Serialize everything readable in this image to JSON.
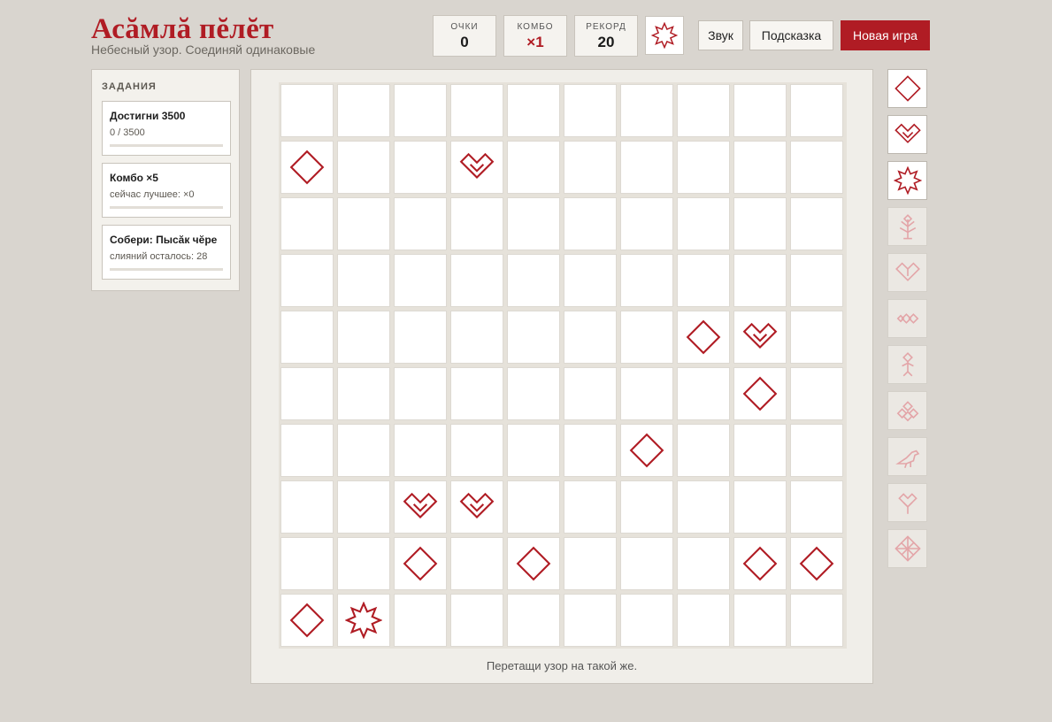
{
  "header": {
    "title": "Асăмлă пĕлĕт",
    "subtitle": "Небесный узор. Соединяй одинаковые"
  },
  "stats": {
    "score": {
      "label": "ОЧКИ",
      "value": "0"
    },
    "combo": {
      "label": "КОМБО",
      "value": "×1"
    },
    "record": {
      "label": "РЕКОРД",
      "value": "20"
    }
  },
  "toolbar": {
    "sound_label": "Звук",
    "hint_label": "Подсказка",
    "new_game_label": "Новая игра"
  },
  "tasks": {
    "heading": "ЗАДАНИЯ",
    "items": [
      {
        "title": "Достигни 3500",
        "subtitle": "0 / 3500",
        "progress": 0
      },
      {
        "title": "Комбо ×5",
        "subtitle": "сейчас лучшее: ×0",
        "progress": 0
      },
      {
        "title": "Собери: Пысăк чĕре",
        "subtitle": "слияний осталось: 28",
        "progress": 0
      }
    ]
  },
  "board": {
    "rows": 10,
    "cols": 10,
    "tiles": [
      {
        "row": 1,
        "col": 0,
        "pattern": "diamond"
      },
      {
        "row": 1,
        "col": 3,
        "pattern": "heart"
      },
      {
        "row": 4,
        "col": 7,
        "pattern": "diamond"
      },
      {
        "row": 4,
        "col": 8,
        "pattern": "heart"
      },
      {
        "row": 5,
        "col": 8,
        "pattern": "diamond"
      },
      {
        "row": 6,
        "col": 6,
        "pattern": "diamond"
      },
      {
        "row": 7,
        "col": 2,
        "pattern": "heart"
      },
      {
        "row": 7,
        "col": 3,
        "pattern": "heart"
      },
      {
        "row": 8,
        "col": 2,
        "pattern": "diamond"
      },
      {
        "row": 8,
        "col": 4,
        "pattern": "diamond"
      },
      {
        "row": 8,
        "col": 8,
        "pattern": "diamond"
      },
      {
        "row": 8,
        "col": 9,
        "pattern": "diamond"
      },
      {
        "row": 9,
        "col": 0,
        "pattern": "diamond"
      },
      {
        "row": 9,
        "col": 1,
        "pattern": "star"
      }
    ],
    "hint_text": "Перетащи узор на такой же."
  },
  "progression": [
    {
      "pattern": "diamond",
      "unlocked": true
    },
    {
      "pattern": "heart",
      "unlocked": true
    },
    {
      "pattern": "star",
      "unlocked": true
    },
    {
      "pattern": "tree",
      "unlocked": false
    },
    {
      "pattern": "heart-cross",
      "unlocked": false
    },
    {
      "pattern": "triple-diamond",
      "unlocked": false
    },
    {
      "pattern": "figure",
      "unlocked": false
    },
    {
      "pattern": "diamond-cluster",
      "unlocked": false
    },
    {
      "pattern": "bird",
      "unlocked": false
    },
    {
      "pattern": "branch",
      "unlocked": false
    },
    {
      "pattern": "lattice",
      "unlocked": false
    }
  ],
  "colors": {
    "accent": "#b01c24",
    "locked": "#e3a5a8"
  }
}
